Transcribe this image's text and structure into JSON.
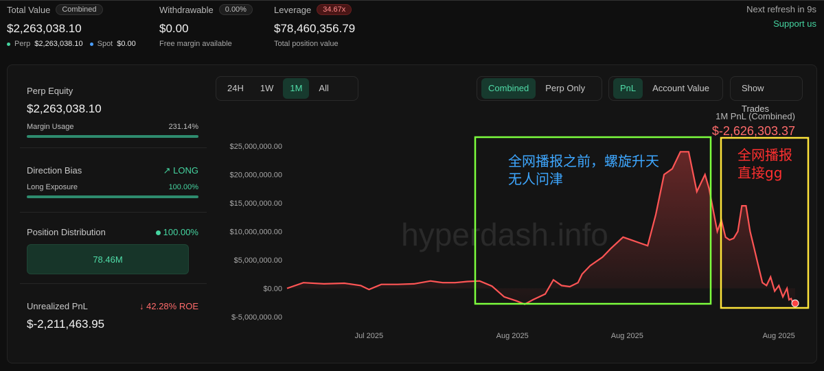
{
  "header": {
    "total_value": {
      "label": "Total Value",
      "badge": "Combined",
      "value": "$2,263,038.10",
      "perp_label": "Perp",
      "perp_value": "$2,263,038.10",
      "spot_label": "Spot",
      "spot_value": "$0.00"
    },
    "withdrawable": {
      "label": "Withdrawable",
      "badge": "0.00%",
      "value": "$0.00",
      "sub": "Free margin available"
    },
    "leverage": {
      "label": "Leverage",
      "badge": "34.67x",
      "value": "$78,460,356.79",
      "sub": "Total position value"
    },
    "refresh": "Next refresh in 9s",
    "support": "Support us"
  },
  "left": {
    "perp_equity": {
      "label": "Perp Equity",
      "value": "$2,263,038.10",
      "margin_label": "Margin Usage",
      "margin_value": "231.14%",
      "margin_fill": 1.0
    },
    "direction": {
      "label": "Direction Bias",
      "value": "LONG",
      "exposure_label": "Long Exposure",
      "exposure_value": "100.00%",
      "exposure_fill": 1.0
    },
    "distribution": {
      "label": "Position Distribution",
      "pct": "100.00%",
      "box": "78.46M"
    },
    "unrealized": {
      "label": "Unrealized PnL",
      "roe": "42.28% ROE",
      "value": "$-2,211,463.95"
    }
  },
  "controls": {
    "time": [
      "24H",
      "1W",
      "1M",
      "All"
    ],
    "time_active": 2,
    "mode": [
      "Combined",
      "Perp Only"
    ],
    "mode_active": 0,
    "metric": [
      "PnL",
      "Account Value"
    ],
    "metric_active": 0,
    "show_trades": "Show Trades"
  },
  "chart_data": {
    "type": "area",
    "title": "1M PnL (Combined)",
    "headline_value": "$-2,626,303.37",
    "watermark": "hyperdash.info",
    "ylim": [
      -5000000,
      25000000
    ],
    "yticks": [
      25000000,
      20000000,
      15000000,
      10000000,
      5000000,
      0,
      -5000000
    ],
    "ytick_labels": [
      "$25,000,000.00",
      "$20,000,000.00",
      "$15,000,000.00",
      "$10,000,000.00",
      "$5,000,000.00",
      "$0.00",
      "$-5,000,000.00"
    ],
    "xtick_labels": [
      "Jul 2025",
      "Aug 2025",
      "Aug 2025",
      "Aug 2025"
    ],
    "xtick_pos": [
      0.2,
      0.55,
      0.83,
      1.2
    ],
    "xlim": [
      0,
      1.25
    ],
    "grid": false,
    "series": [
      {
        "line_color": "#ff5555",
        "x": [
          0,
          0.04,
          0.09,
          0.14,
          0.18,
          0.2,
          0.23,
          0.27,
          0.31,
          0.35,
          0.38,
          0.41,
          0.44,
          0.47,
          0.5,
          0.53,
          0.56,
          0.58,
          0.6,
          0.63,
          0.65,
          0.67,
          0.69,
          0.71,
          0.72,
          0.74,
          0.77,
          0.79,
          0.82,
          0.84,
          0.86,
          0.88,
          0.9,
          0.92,
          0.94,
          0.96,
          0.98,
          1.0,
          1.02,
          1.03,
          1.05,
          1.06,
          1.07,
          1.08,
          1.09,
          1.1,
          1.11,
          1.12,
          1.13,
          1.14,
          1.15,
          1.16,
          1.17,
          1.18,
          1.19,
          1.2,
          1.21,
          1.22,
          1.225,
          1.23,
          1.235,
          1.24
        ],
        "values": [
          0,
          1000000,
          800000,
          900000,
          500000,
          -200000,
          700000,
          700000,
          800000,
          1300000,
          1000000,
          1000000,
          1200000,
          1300000,
          400000,
          -1500000,
          -2200000,
          -2800000,
          -2000000,
          -1000000,
          1500000,
          500000,
          300000,
          1000000,
          2500000,
          4000000,
          5500000,
          7000000,
          9000000,
          8500000,
          8000000,
          7500000,
          13000000,
          20000000,
          21000000,
          24000000,
          24000000,
          17000000,
          20000000,
          17500000,
          10000000,
          12000000,
          9000000,
          8500000,
          8800000,
          10000000,
          14500000,
          14500000,
          10000000,
          7000000,
          4000000,
          1000000,
          500000,
          2000000,
          -500000,
          500000,
          -1500000,
          0,
          -2000000,
          -1800000,
          -2600000,
          -2626303
        ]
      }
    ],
    "annotations": [
      {
        "text_line1": "全网播报之前，螺旋升天",
        "text_line2": "无人问津",
        "color": "#3ea7ff",
        "box_color": "#7dff3e"
      },
      {
        "text_line1": "全网播报",
        "text_line2": "直接gg",
        "color": "#ff3030",
        "box_color": "#ffe53b"
      }
    ]
  }
}
